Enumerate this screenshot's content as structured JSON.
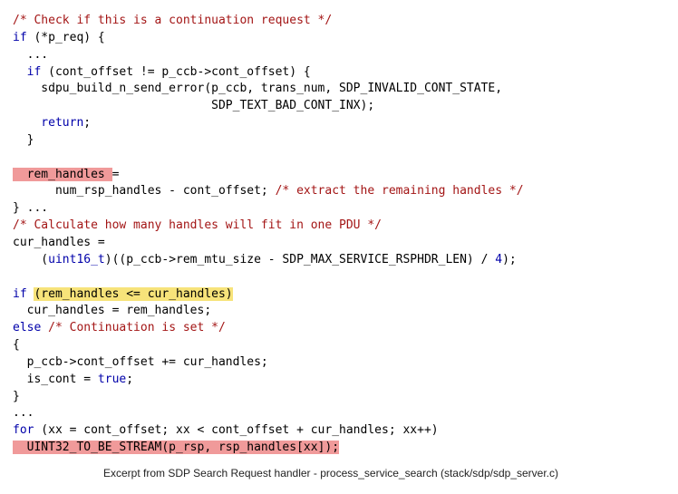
{
  "code": {
    "l01": "/* Check if this is a continuation request */",
    "l02a": "if",
    "l02b": " (*p_req) {",
    "l03": "  ...",
    "l04a": "  if",
    "l04b": " (cont_offset != p_ccb->cont_offset) {",
    "l05": "    sdpu_build_n_send_error(p_ccb, trans_num, SDP_INVALID_CONT_STATE,",
    "l06": "                            SDP_TEXT_BAD_CONT_INX);",
    "l07a": "    return",
    "l07b": ";",
    "l08": "  }",
    "l09": "",
    "l10a": "  rem_handles ",
    "l10b": "=",
    "l11a": "      num_rsp_handles - cont_offset; ",
    "l11b": "/* extract the remaining handles */",
    "l12": "} ...",
    "l13": "/* Calculate how many handles will fit in one PDU */",
    "l14": "cur_handles =",
    "l15a": "    (",
    "l15b": "uint16_t",
    "l15c": ")((p_ccb->rem_mtu_size - SDP_MAX_SERVICE_RSPHDR_LEN) / ",
    "l15d": "4",
    "l15e": ");",
    "l16": "",
    "l17a": "if",
    "l17b": " ",
    "l17c": "(rem_handles <= cur_handles)",
    "l18": "  cur_handles = rem_handles;",
    "l19a": "else",
    "l19b": " ",
    "l19c": "/* Continuation is set */",
    "l20": "{",
    "l21": "  p_ccb->cont_offset += cur_handles;",
    "l22a": "  is_cont = ",
    "l22b": "true",
    "l22c": ";",
    "l23": "}",
    "l24": "...",
    "l25a": "for",
    "l25b": " (xx = cont_offset; xx < cont_offset + cur_handles; xx++)",
    "l26": "  UINT32_TO_BE_STREAM(p_rsp, rsp_handles[xx]);"
  },
  "caption": "Excerpt from SDP Search Request handler - process_service_search (stack/sdp/sdp_server.c)"
}
